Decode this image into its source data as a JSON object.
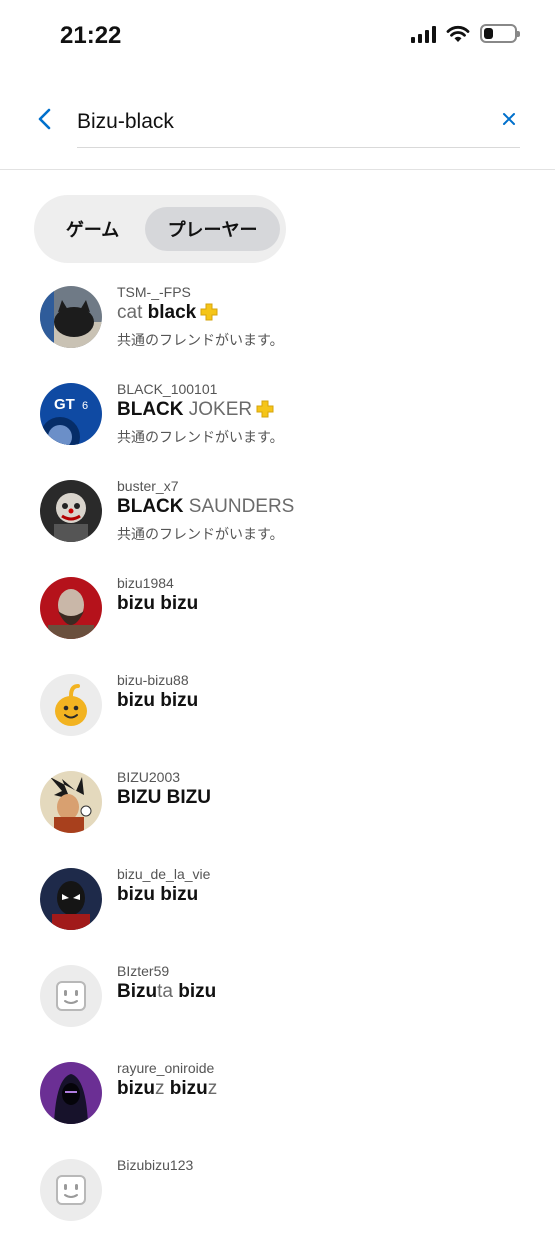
{
  "status": {
    "time": "21:22"
  },
  "search": {
    "value": "Bizu-black"
  },
  "tabs": {
    "games": "ゲーム",
    "players": "プレーヤー",
    "selected": "players"
  },
  "mutual_text": "共通のフレンドがいます。",
  "results": [
    {
      "online_id": "TSM-_-FPS",
      "name_parts": [
        {
          "t": "cat ",
          "b": false
        },
        {
          "t": "black",
          "b": true
        }
      ],
      "plus": true,
      "mutual": true,
      "avatar": "cat-photo"
    },
    {
      "online_id": "BLACK_100101",
      "name_parts": [
        {
          "t": "BLACK",
          "b": true
        },
        {
          "t": " JOKER",
          "b": false
        }
      ],
      "plus": true,
      "mutual": true,
      "avatar": "gran-turismo-6"
    },
    {
      "online_id": "buster_x7",
      "name_parts": [
        {
          "t": "BLACK",
          "b": true
        },
        {
          "t": " SAUNDERS",
          "b": false
        }
      ],
      "plus": false,
      "mutual": true,
      "avatar": "clown"
    },
    {
      "online_id": "bizu1984",
      "name_parts": [
        {
          "t": "bizu bizu",
          "b": true
        }
      ],
      "plus": false,
      "mutual": false,
      "avatar": "kratos"
    },
    {
      "online_id": "bizu-bizu88",
      "name_parts": [
        {
          "t": "bizu bizu",
          "b": true
        }
      ],
      "plus": false,
      "mutual": false,
      "avatar": "yellow-blob"
    },
    {
      "online_id": "BIZU2003",
      "name_parts": [
        {
          "t": "BIZU BIZU",
          "b": true
        }
      ],
      "plus": false,
      "mutual": false,
      "avatar": "anime-fighter"
    },
    {
      "online_id": "bizu_de_la_vie",
      "name_parts": [
        {
          "t": "bizu bizu",
          "b": true
        }
      ],
      "plus": false,
      "mutual": false,
      "avatar": "spider-man"
    },
    {
      "online_id": "BIzter59",
      "name_parts": [
        {
          "t": "Bizu",
          "b": true
        },
        {
          "t": "ta",
          "b": false
        },
        {
          "t": " bizu",
          "b": true
        }
      ],
      "plus": false,
      "mutual": false,
      "avatar": "default-face"
    },
    {
      "online_id": "rayure_oniroide",
      "name_parts": [
        {
          "t": "bizu",
          "b": true
        },
        {
          "t": "z",
          "b": false
        },
        {
          "t": " bizu",
          "b": true
        },
        {
          "t": "z",
          "b": false
        }
      ],
      "plus": false,
      "mutual": false,
      "avatar": "hooded-figure"
    },
    {
      "online_id": "Bizubizu123",
      "name_parts": [],
      "plus": false,
      "mutual": false,
      "avatar": "default-face"
    }
  ],
  "colors": {
    "accent": "#0070cc",
    "plus_gold": "#f5c518"
  }
}
